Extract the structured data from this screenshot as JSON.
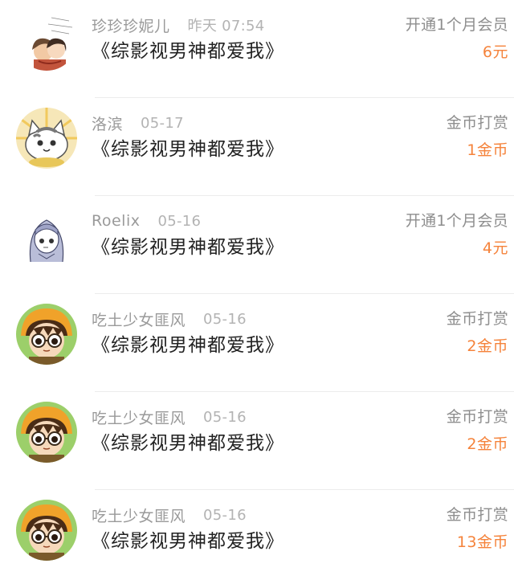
{
  "colors": {
    "username": "#9a9a9a",
    "time": "#b3b3b3",
    "book_title": "#222222",
    "action": "#8e8e8e",
    "amount": "#f5833b",
    "divider": "#ececec"
  },
  "records": [
    {
      "avatar_icon": "anime-couple-avatar-icon",
      "username": "珍珍珍妮儿",
      "time": "昨天 07:54",
      "book_title": "《综影视男神都爱我》",
      "action": "开通1个月会员",
      "amount": "6元"
    },
    {
      "avatar_icon": "cat-avatar-icon",
      "username": "洛滨",
      "time": "05-17",
      "book_title": "《综影视男神都爱我》",
      "action": "金币打赏",
      "amount": "1金币"
    },
    {
      "avatar_icon": "anime-girl-sketch-avatar-icon",
      "username": "Roelix",
      "time": "05-16",
      "book_title": "《综影视男神都爱我》",
      "action": "开通1个月会员",
      "amount": "4元"
    },
    {
      "avatar_icon": "glasses-girl-avatar-icon",
      "username": "吃土少女匪风",
      "time": "05-16",
      "book_title": "《综影视男神都爱我》",
      "action": "金币打赏",
      "amount": "2金币"
    },
    {
      "avatar_icon": "glasses-girl-avatar-icon",
      "username": "吃土少女匪风",
      "time": "05-16",
      "book_title": "《综影视男神都爱我》",
      "action": "金币打赏",
      "amount": "2金币"
    },
    {
      "avatar_icon": "glasses-girl-avatar-icon",
      "username": "吃土少女匪风",
      "time": "05-16",
      "book_title": "《综影视男神都爱我》",
      "action": "金币打赏",
      "amount": "13金币"
    }
  ]
}
